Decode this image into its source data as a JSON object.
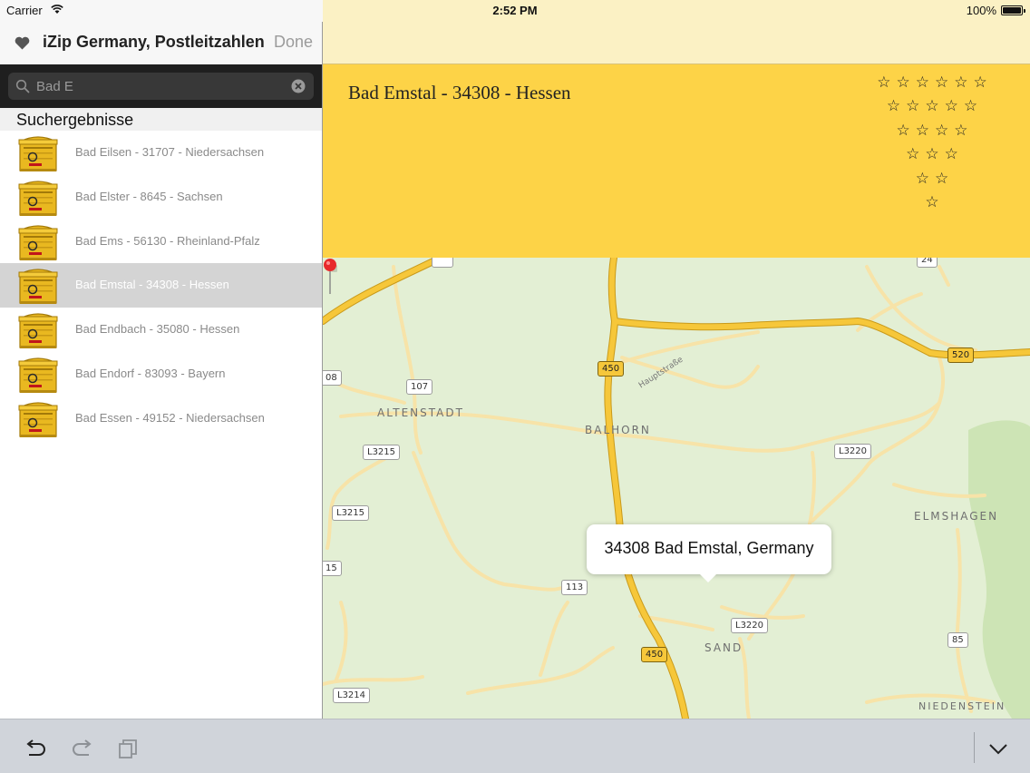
{
  "status_bar": {
    "carrier": "Carrier",
    "time": "2:52 PM",
    "battery": "100%",
    "wifi_icon": "wifi-icon",
    "battery_icon": "battery-icon"
  },
  "master": {
    "title": "iZip Germany, Postleitzahlen",
    "done_label": "Done",
    "favorite_icon": "heart-icon",
    "search": {
      "value": "Bad E",
      "placeholder": "",
      "icon": "search-icon",
      "clear_icon": "clear-icon"
    },
    "section_title": "Suchergebnisse",
    "results": [
      {
        "label": "Bad Eilsen - 31707 - Niedersachsen",
        "icon": "mailbox-icon",
        "selected": false
      },
      {
        "label": "Bad Elster - 8645 - Sachsen",
        "icon": "mailbox-icon",
        "selected": false
      },
      {
        "label": "Bad Ems - 56130 - Rheinland-Pfalz",
        "icon": "mailbox-icon",
        "selected": false
      },
      {
        "label": "Bad Emstal - 34308 - Hessen",
        "icon": "mailbox-icon",
        "selected": true
      },
      {
        "label": "Bad Endbach - 35080 - Hessen",
        "icon": "mailbox-icon",
        "selected": false
      },
      {
        "label": "Bad Endorf - 83093 - Bayern",
        "icon": "mailbox-icon",
        "selected": false
      },
      {
        "label": "Bad Essen - 49152 - Niedersachsen",
        "icon": "mailbox-icon",
        "selected": false
      }
    ]
  },
  "detail": {
    "title": "Bad Emstal - 34308 - Hessen",
    "star_rows": [
      6,
      5,
      4,
      3,
      2,
      1
    ],
    "star_glyph": "☆"
  },
  "map": {
    "callout": "34308 Bad Emstal, Germany",
    "pin_icon": "map-pin-icon",
    "place_labels": [
      "ALTENSTADT",
      "BALHORN",
      "ELMSHAGEN",
      "SAND",
      "NIEDENSTEIN"
    ],
    "street_label": "Hauptstraße",
    "road_shields": {
      "r24": "24",
      "r450a": "450",
      "r520": "520",
      "r108": "08",
      "r107": "107",
      "l3215a": "L3215",
      "l3220a": "L3220",
      "l3215b": "L3215",
      "r15": "15",
      "r113": "113",
      "l3220b": "L3220",
      "r450b": "450",
      "r85": "85",
      "l3214": "L3214"
    }
  },
  "toolbar": {
    "undo_icon": "undo-icon",
    "redo_icon": "redo-icon",
    "copy_icon": "copy-icon",
    "collapse_icon": "chevron-down-icon"
  },
  "colors": {
    "banner": "#fdd347",
    "nav_detail": "#fbf1c4",
    "map_land": "#e3efd4",
    "road_major": "#f6c73a",
    "selected_row": "#d4d4d4",
    "pin": "#e8292b"
  }
}
